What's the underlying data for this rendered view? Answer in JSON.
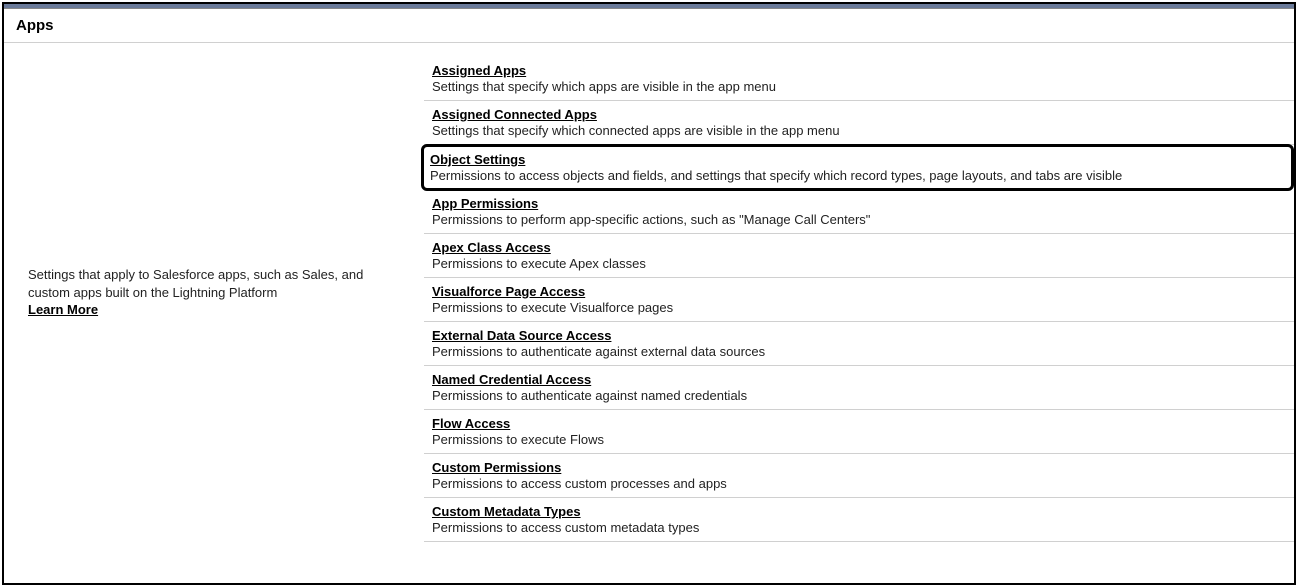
{
  "section_title": "Apps",
  "left_panel": {
    "description": "Settings that apply to Salesforce apps, such as Sales, and custom apps built on the Lightning Platform",
    "learn_more": "Learn More"
  },
  "items": [
    {
      "title": "Assigned Apps",
      "description": "Settings that specify which apps are visible in the app menu",
      "highlighted": false
    },
    {
      "title": "Assigned Connected Apps",
      "description": "Settings that specify which connected apps are visible in the app menu",
      "highlighted": false
    },
    {
      "title": "Object Settings",
      "description": "Permissions to access objects and fields, and settings that specify which record types, page layouts, and tabs are visible",
      "highlighted": true
    },
    {
      "title": "App Permissions",
      "description": "Permissions to perform app-specific actions, such as \"Manage Call Centers\"",
      "highlighted": false
    },
    {
      "title": "Apex Class Access",
      "description": "Permissions to execute Apex classes",
      "highlighted": false
    },
    {
      "title": "Visualforce Page Access",
      "description": "Permissions to execute Visualforce pages",
      "highlighted": false
    },
    {
      "title": "External Data Source Access",
      "description": "Permissions to authenticate against external data sources",
      "highlighted": false
    },
    {
      "title": "Named Credential Access",
      "description": "Permissions to authenticate against named credentials",
      "highlighted": false
    },
    {
      "title": "Flow Access",
      "description": "Permissions to execute Flows",
      "highlighted": false
    },
    {
      "title": "Custom Permissions",
      "description": "Permissions to access custom processes and apps",
      "highlighted": false
    },
    {
      "title": "Custom Metadata Types",
      "description": "Permissions to access custom metadata types",
      "highlighted": false
    }
  ]
}
